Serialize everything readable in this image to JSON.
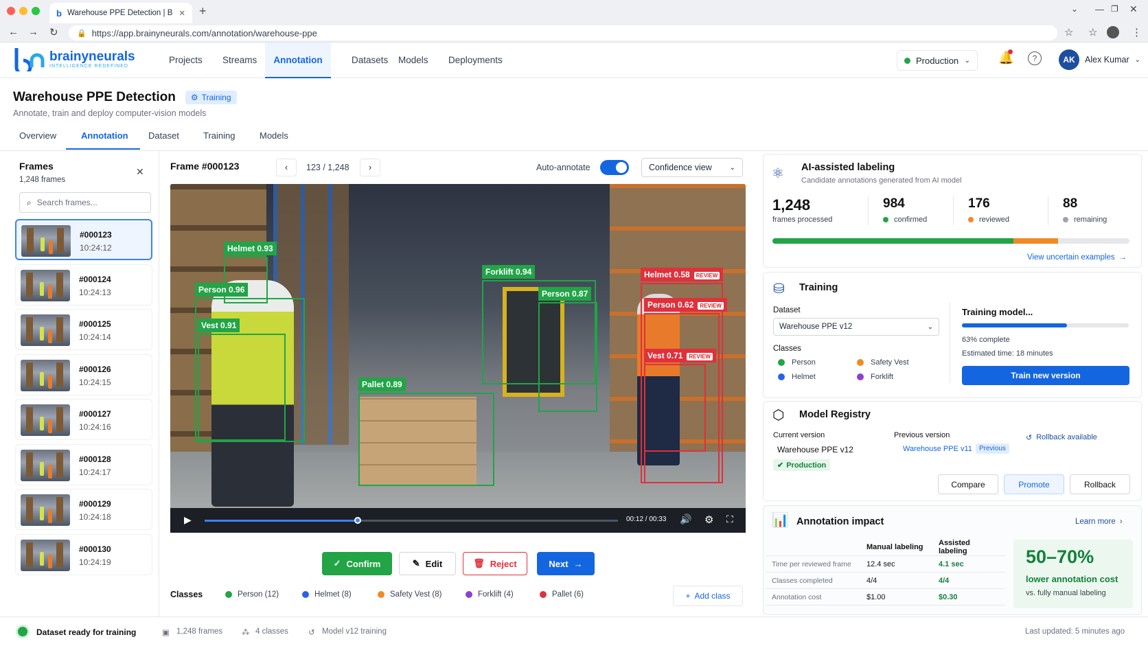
{
  "browser": {
    "tab_title": "Warehouse PPE Detection | Br",
    "url": "https://app.brainyneurals.com/annotation/warehouse-ppe"
  },
  "app": {
    "logo_name": "brainyneurals",
    "logo_tagline": "INTELLIGENCE REDEFINED",
    "nav": [
      "Projects",
      "Streams",
      "Annotation",
      "Datasets",
      "Models",
      "Deployments"
    ],
    "environment": "Production",
    "user": {
      "initials": "AK",
      "name": "Alex Kumar"
    }
  },
  "page": {
    "title": "Warehouse PPE Detection",
    "status": "Training",
    "subtitle": "Annotate, train and deploy computer-vision models",
    "tabs": [
      "Overview",
      "Annotation",
      "Dataset",
      "Training",
      "Models"
    ]
  },
  "frames_panel": {
    "title": "Frames",
    "count": "1,248 frames",
    "search_placeholder": "Search frames...",
    "items": [
      {
        "id": "#000123",
        "time": "10:24:12"
      },
      {
        "id": "#000124",
        "time": "10:24:13"
      },
      {
        "id": "#000125",
        "time": "10:24:14"
      },
      {
        "id": "#000126",
        "time": "10:24:15"
      },
      {
        "id": "#000127",
        "time": "10:24:16"
      },
      {
        "id": "#000128",
        "time": "10:24:17"
      },
      {
        "id": "#000129",
        "time": "10:24:18"
      },
      {
        "id": "#000130",
        "time": "10:24:19"
      }
    ]
  },
  "viewer": {
    "frame_title": "Frame #000123",
    "position": "123 / 1,248",
    "auto_annotate_label": "Auto-annotate",
    "auto_annotate": true,
    "view_select": "Confidence view",
    "playback_time": "00:12 / 00:33",
    "progress": 0.37,
    "detections": [
      {
        "label": "Helmet 0.93",
        "color": "#22a447",
        "review": false
      },
      {
        "label": "Person 0.96",
        "color": "#22a447",
        "review": false
      },
      {
        "label": "Vest 0.91",
        "color": "#22a447",
        "review": false
      },
      {
        "label": "Forklift 0.94",
        "color": "#22a447",
        "review": false
      },
      {
        "label": "Person 0.87",
        "color": "#22a447",
        "review": false
      },
      {
        "label": "Pallet 0.89",
        "color": "#22a447",
        "review": false
      },
      {
        "label": "Helmet 0.58",
        "color": "#e0303b",
        "review": true
      },
      {
        "label": "Person 0.62",
        "color": "#e0303b",
        "review": true
      },
      {
        "label": "Vest 0.71",
        "color": "#e0303b",
        "review": true
      }
    ],
    "review_tag": "REVIEW",
    "actions": {
      "confirm": "Confirm",
      "edit": "Edit",
      "reject": "Reject",
      "next": "Next"
    },
    "classes_title": "Classes",
    "classes": [
      {
        "name": "Person (12)",
        "color": "#22a447"
      },
      {
        "name": "Helmet (8)",
        "color": "#2563eb"
      },
      {
        "name": "Safety Vest (8)",
        "color": "#f08a24"
      },
      {
        "name": "Forklift (4)",
        "color": "#8b3fd9"
      },
      {
        "name": "Pallet (6)",
        "color": "#e0303b"
      }
    ],
    "add_class": "Add class"
  },
  "ai_labeling": {
    "title": "AI-assisted labeling",
    "subtitle": "Candidate annotations generated from AI model",
    "stats": [
      {
        "value": "1,248",
        "label": "frames processed",
        "color": ""
      },
      {
        "value": "984",
        "label": "confirmed",
        "color": "#22a447"
      },
      {
        "value": "176",
        "label": "reviewed",
        "color": "#f08a24"
      },
      {
        "value": "88",
        "label": "remaining",
        "color": "#9ca3af"
      }
    ],
    "bar_fractions": [
      0.675,
      0.125
    ],
    "link": "View uncertain examples"
  },
  "training": {
    "title": "Training",
    "dataset_label": "Dataset",
    "dataset_value": "Warehouse PPE v12",
    "classes_label": "Classes",
    "classes": [
      {
        "name": "Person",
        "color": "#22a447"
      },
      {
        "name": "Safety Vest",
        "color": "#f08a24"
      },
      {
        "name": "Helmet",
        "color": "#2563eb"
      },
      {
        "name": "Forklift",
        "color": "#8b3fd9"
      }
    ],
    "model_title": "Training model...",
    "progress": 0.63,
    "progress_text": "63% complete",
    "eta": "Estimated time: 18 minutes",
    "button": "Train new version"
  },
  "registry": {
    "title": "Model Registry",
    "current_label": "Current version",
    "current_value": "Warehouse PPE v12",
    "current_badge": "Production",
    "previous_label": "Previous version",
    "previous_value": "Warehouse PPE v11",
    "previous_badge": "Previous",
    "rollback_note": "Rollback available",
    "buttons": [
      "Compare",
      "Promote",
      "Rollback"
    ]
  },
  "impact": {
    "title": "Annotation impact",
    "link": "Learn more",
    "headers": [
      "",
      "Manual labeling",
      "Assisted labeling"
    ],
    "rows": [
      [
        "Time per reviewed frame",
        "12.4 sec",
        "4.1 sec"
      ],
      [
        "Classes completed",
        "4/4",
        "4/4"
      ],
      [
        "Annotation cost",
        "$1.00",
        "$0.30"
      ]
    ],
    "highlight": "50–70%",
    "highlight_label": "lower annotation cost",
    "highlight_sub": "vs. fully manual labeling"
  },
  "footer": {
    "status": "Dataset ready for training",
    "frames": "1,248 frames",
    "classes": "4 classes",
    "model": "Model v12 training",
    "updated": "Last updated: 5 minutes ago"
  }
}
